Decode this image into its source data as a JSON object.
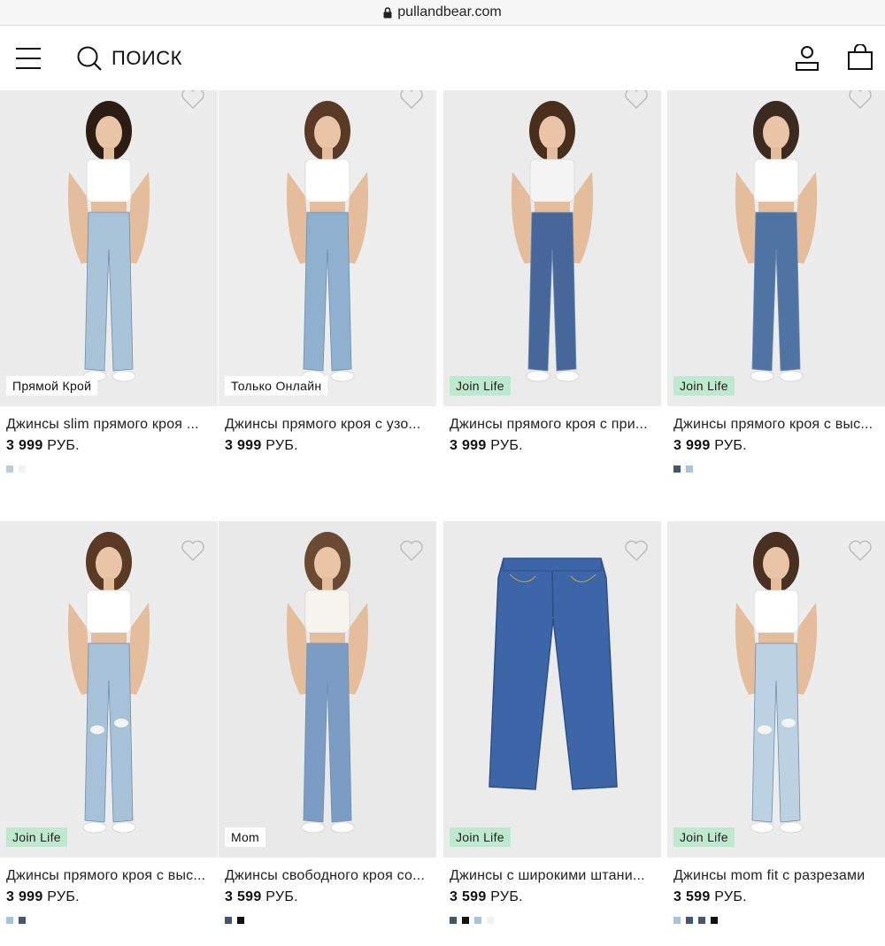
{
  "browser": {
    "url": "pullandbear.com"
  },
  "header": {
    "search_label": "ПОИСК"
  },
  "products": [
    {
      "badge": "Прямой Крой",
      "badge_style": "white",
      "title": "Джинсы slim прямого кроя ...",
      "price": "3 999",
      "currency": "РУБ.",
      "swatches": [
        "#b9cfe0",
        "#eef2f5"
      ],
      "bg": "#ececec",
      "jeans": "#a9c3d9",
      "top": "#ffffff",
      "hair": "#2b1d14"
    },
    {
      "badge": "Только Онлайн",
      "badge_style": "white",
      "title": "Джинсы прямого кроя с узо...",
      "price": "3 999",
      "currency": "РУБ.",
      "swatches": [],
      "bg": "#ededed",
      "jeans": "#8fb0cf",
      "top": "#ffffff",
      "hair": "#5a3a26"
    },
    {
      "badge": "Join Life",
      "badge_style": "green",
      "title": "Джинсы прямого кроя с при...",
      "price": "3 999",
      "currency": "РУБ.",
      "swatches": [],
      "bg": "#ebebeb",
      "jeans": "#47679a",
      "top": "#f4f4f4",
      "hair": "#4a2e1d"
    },
    {
      "badge": "Join Life",
      "badge_style": "green",
      "title": "Джинсы прямого кроя с выс...",
      "price": "3 999",
      "currency": "РУБ.",
      "swatches": [
        "#3f5870",
        "#a9c3d8"
      ],
      "bg": "#ececec",
      "jeans": "#4f73a3",
      "top": "#ffffff",
      "hair": "#3a2a1f"
    },
    {
      "badge": "Join Life",
      "badge_style": "green",
      "title": "Джинсы прямого кроя с выс...",
      "price": "3 999",
      "currency": "РУБ.",
      "swatches": [
        "#a9c3d8",
        "#3f5870"
      ],
      "bg": "#ececec",
      "jeans": "#a7c1d8",
      "top": "#ffffff",
      "hair": "#5a3a25"
    },
    {
      "badge": "Mom",
      "badge_style": "white",
      "title": "Джинсы свободного кроя со...",
      "price": "3 599",
      "currency": "РУБ.",
      "swatches": [
        "#3f5870",
        "#111111"
      ],
      "bg": "#e9e9e9",
      "jeans": "#7b9dc4",
      "top": "#f6f4ef",
      "hair": "#6b4a33"
    },
    {
      "badge": "Join Life",
      "badge_style": "green",
      "title": "Джинсы с широкими штани...",
      "price": "3 599",
      "currency": "РУБ.",
      "swatches": [
        "#3f5870",
        "#111111",
        "#a9c3d8",
        "#eef2f5"
      ],
      "bg": "#ebebeb",
      "jeans": "#3c66a8",
      "top": "",
      "hair": ""
    },
    {
      "badge": "Join Life",
      "badge_style": "green",
      "title": "Джинсы mom fit с разрезами",
      "price": "3 599",
      "currency": "РУБ.",
      "swatches": [
        "#a9c3d8",
        "#3f5870",
        "#3f5870",
        "#111111"
      ],
      "bg": "#ececec",
      "jeans": "#bcd1e2",
      "top": "#ffffff",
      "hair": "#4a3022"
    }
  ]
}
